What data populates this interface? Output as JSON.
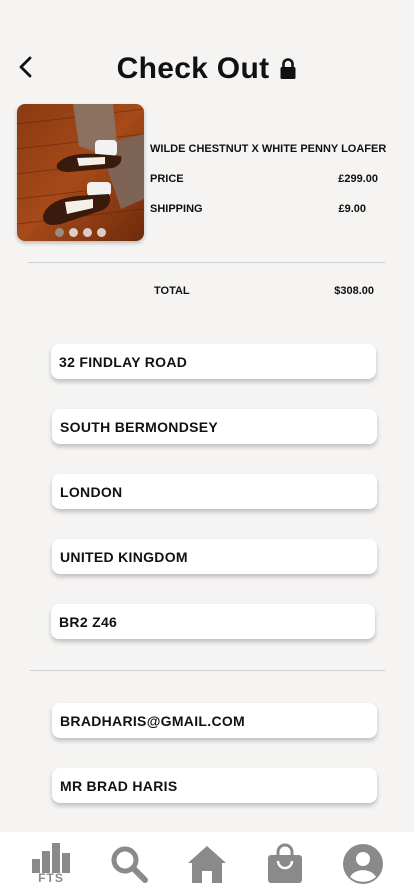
{
  "header": {
    "title": "Check Out",
    "back_icon": "chevron-left-icon",
    "lock_icon": "lock-icon"
  },
  "product": {
    "name": "WILDE CHESTNUT X WHITE PENNY LOAFER",
    "price_label": "PRICE",
    "price_value": "£299.00",
    "shipping_label": "SHIPPING",
    "shipping_value": "£9.00",
    "image_count": 4,
    "active_image": 0
  },
  "summary": {
    "total_label": "TOTAL",
    "total_value": "$308.00"
  },
  "address": {
    "line1": "32 FINDLAY ROAD",
    "line2": "SOUTH BERMONDSEY",
    "city": "LONDON",
    "country": "UNITED KINGDOM",
    "postcode": "BR2 Z46"
  },
  "contact": {
    "email": "BRADHARIS@GMAIL.COM",
    "name": "MR BRAD HARIS"
  },
  "nav": {
    "logo_text": "FTS",
    "items": [
      "fts-logo-icon",
      "search-icon",
      "home-icon",
      "shopping-bag-icon",
      "account-icon"
    ]
  },
  "colors": {
    "background": "#f5f4f3",
    "nav_icon": "#8a8a8a",
    "field_bg": "#ffffff"
  }
}
